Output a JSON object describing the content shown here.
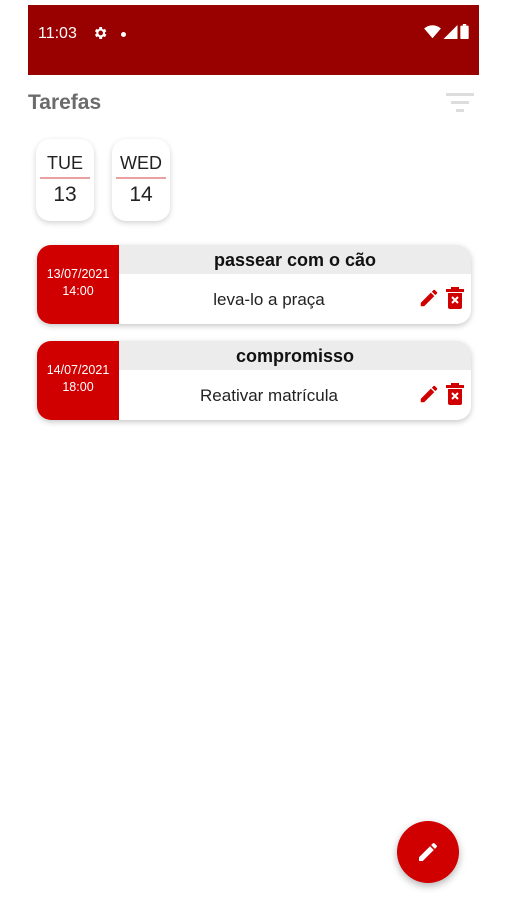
{
  "status_bar": {
    "time": "11:03",
    "icons": [
      "gear-icon",
      "notification-dot",
      "wifi-icon",
      "signal-icon",
      "battery-icon"
    ],
    "color": "#990000"
  },
  "app_bar": {
    "title": "Tarefas",
    "action_icon": "filter-icon"
  },
  "days": [
    {
      "dow": "TUE",
      "dom": "13"
    },
    {
      "dow": "WED",
      "dom": "14"
    }
  ],
  "tasks": [
    {
      "date": "13/07/2021",
      "time": "14:00",
      "title": "passear com o cão",
      "description": "leva-lo a praça"
    },
    {
      "date": "14/07/2021",
      "time": "18:00",
      "title": "compromisso",
      "description": "Reativar matrícula"
    }
  ],
  "fab": {
    "icon": "pencil-icon"
  },
  "colors": {
    "accent": "#d00000",
    "status_bar": "#990000",
    "title_bar": "#ececec",
    "title_text": "#6b6b6b"
  }
}
